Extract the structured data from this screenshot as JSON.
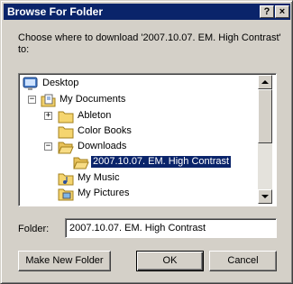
{
  "window": {
    "title": "Browse For Folder",
    "help_label": "?",
    "close_label": "×"
  },
  "prompt": "Choose where to download '2007.10.07. EM. High Contrast' to:",
  "tree": {
    "items": [
      {
        "label": "Desktop",
        "icon": "desktop-icon",
        "expander": ""
      },
      {
        "label": "My Documents",
        "icon": "my-documents-icon",
        "expander": "−"
      },
      {
        "label": "Ableton",
        "icon": "folder-icon",
        "expander": "+"
      },
      {
        "label": "Color Books",
        "icon": "folder-icon",
        "expander": ""
      },
      {
        "label": "Downloads",
        "icon": "folder-open-icon",
        "expander": "−"
      },
      {
        "label": "2007.10.07. EM. High Contrast",
        "icon": "folder-open-icon",
        "expander": "",
        "selected": true
      },
      {
        "label": "My Music",
        "icon": "music-folder-icon",
        "expander": ""
      },
      {
        "label": "My Pictures",
        "icon": "pictures-folder-icon",
        "expander": ""
      }
    ]
  },
  "folder_field": {
    "label": "Folder:",
    "value": "2007.10.07. EM. High Contrast"
  },
  "buttons": {
    "new_folder": "Make New Folder",
    "ok": "OK",
    "cancel": "Cancel"
  },
  "colors": {
    "title_bar": "#0a246a",
    "selection": "#0a246a",
    "dialog_face": "#d4d0c8"
  }
}
